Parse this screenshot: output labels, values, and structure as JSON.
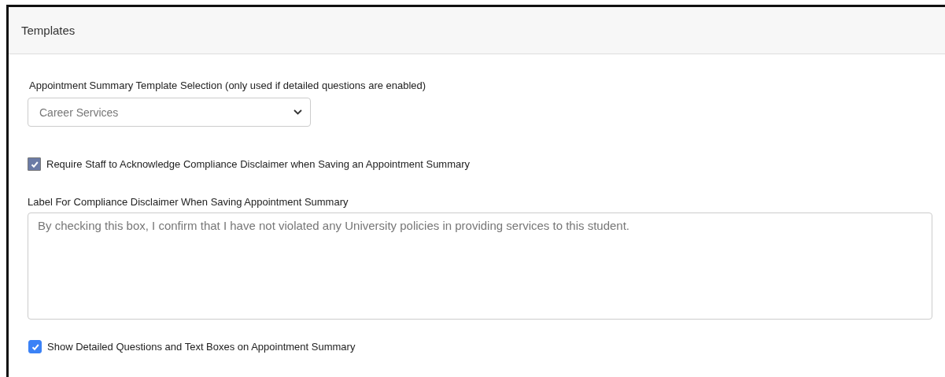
{
  "panel": {
    "title": "Templates"
  },
  "template_select": {
    "label": "Appointment Summary Template Selection (only used if detailed questions are enabled)",
    "value": "Career Services"
  },
  "require_acknowledge": {
    "label": "Require Staff to Acknowledge Compliance Disclaimer when Saving an Appointment Summary",
    "checked": true,
    "disabled": true
  },
  "disclaimer_label": {
    "label": "Label For Compliance Disclaimer When Saving Appointment Summary",
    "value": "By checking this box, I confirm that I have not violated any University policies in providing services to this student."
  },
  "show_detailed": {
    "label": "Show Detailed Questions and Text Boxes on Appointment Summary",
    "checked": true,
    "disabled": false
  }
}
